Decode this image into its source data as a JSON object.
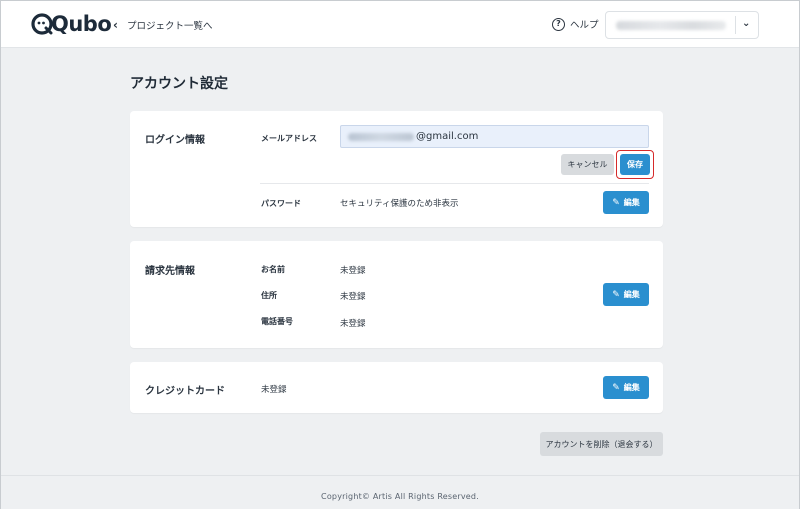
{
  "header": {
    "logo_text": "Qubo",
    "back_label": "プロジェクト一覧へ",
    "help_label": "ヘルプ",
    "account_selector_value": ""
  },
  "page": {
    "title": "アカウント設定"
  },
  "login": {
    "title": "ログイン情報",
    "email_label": "メールアドレス",
    "email_value_visible": "@gmail.com",
    "cancel_label": "キャンセル",
    "save_label": "保存",
    "password_label": "パスワード",
    "password_value": "セキュリティ保護のため非表示",
    "edit_label": "編集"
  },
  "billing": {
    "title": "請求先情報",
    "name_label": "お名前",
    "name_value": "未登録",
    "address_label": "住所",
    "address_value": "未登録",
    "phone_label": "電話番号",
    "phone_value": "未登録",
    "edit_label": "編集"
  },
  "credit": {
    "title": "クレジットカード",
    "value": "未登録",
    "edit_label": "編集"
  },
  "delete_account_label": "アカウントを削除（退会する）",
  "footer": {
    "copyright": "Copyright© Artis All Rights Reserved."
  },
  "colors": {
    "primary": "#2a8fcf",
    "highlight": "#d62a2a",
    "background": "#eef0f2"
  },
  "icons": {
    "back": "chevron-left-icon",
    "help": "question-circle-icon",
    "dropdown": "chevron-down-icon",
    "edit": "pencil-icon"
  }
}
